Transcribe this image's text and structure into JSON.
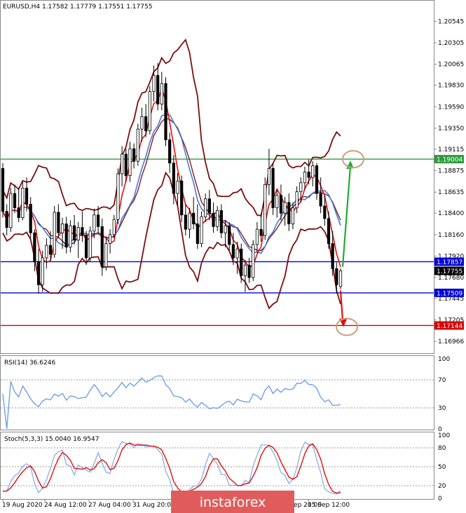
{
  "chart_data": [
    {
      "type": "candlestick",
      "title": "EURUSD,H4  1.17582 1.17779 1.17551 1.17755",
      "ylim": [
        1.1685,
        1.2065
      ],
      "y_ticks": [
        "1.20545",
        "1.20305",
        "1.20065",
        "1.19830",
        "1.19590",
        "1.19350",
        "1.19115",
        "1.18875",
        "1.18635",
        "1.18400",
        "1.18160",
        "1.17920",
        "1.17680",
        "1.17445",
        "1.17205",
        "1.16966"
      ],
      "x_ticks": [
        "19 Aug 2020",
        "24 Aug 12:00",
        "27 Aug 04:00",
        "31 Aug 20:00",
        "",
        "",
        "",
        "10 Sep 20:00",
        "15 Sep 12:00"
      ],
      "levels": [
        {
          "label": "1.19004",
          "value": 1.19004,
          "color": "#2e9b3e"
        },
        {
          "label": "1.17857",
          "value": 1.17857,
          "color": "#0000dd"
        },
        {
          "label": "1.17509",
          "value": 1.17509,
          "color": "#0000dd"
        },
        {
          "label": "1.17144",
          "value": 1.17144,
          "color": "#dd0000"
        }
      ],
      "current_price": "1.17755",
      "ohlc": [
        [
          1.189,
          1.1896,
          1.1835,
          1.1842
        ],
        [
          1.1842,
          1.185,
          1.1815,
          1.1824
        ],
        [
          1.1824,
          1.1868,
          1.1819,
          1.1862
        ],
        [
          1.1862,
          1.1872,
          1.184,
          1.1846
        ],
        [
          1.1846,
          1.1868,
          1.183,
          1.1835
        ],
        [
          1.1835,
          1.1875,
          1.1832,
          1.1868
        ],
        [
          1.1868,
          1.188,
          1.1842,
          1.185
        ],
        [
          1.185,
          1.1858,
          1.1812,
          1.1818
        ],
        [
          1.1818,
          1.1822,
          1.1775,
          1.1786
        ],
        [
          1.1786,
          1.18,
          1.175,
          1.176
        ],
        [
          1.176,
          1.1798,
          1.1752,
          1.179
        ],
        [
          1.179,
          1.1812,
          1.1778,
          1.1804
        ],
        [
          1.1804,
          1.182,
          1.1787,
          1.1794
        ],
        [
          1.1794,
          1.1848,
          1.179,
          1.1841
        ],
        [
          1.1841,
          1.185,
          1.1812,
          1.1818
        ],
        [
          1.1818,
          1.1835,
          1.18,
          1.1828
        ],
        [
          1.1828,
          1.1836,
          1.1795,
          1.1802
        ],
        [
          1.1802,
          1.1832,
          1.1796,
          1.1826
        ],
        [
          1.1826,
          1.1838,
          1.1805,
          1.181
        ],
        [
          1.181,
          1.183,
          1.179,
          1.1824
        ],
        [
          1.1824,
          1.1842,
          1.1808,
          1.1815
        ],
        [
          1.1815,
          1.182,
          1.1782,
          1.179
        ],
        [
          1.179,
          1.1825,
          1.1786,
          1.182
        ],
        [
          1.182,
          1.1845,
          1.1812,
          1.1838
        ],
        [
          1.1838,
          1.1848,
          1.1818,
          1.1825
        ],
        [
          1.1825,
          1.1834,
          1.177,
          1.178
        ],
        [
          1.178,
          1.1812,
          1.1776,
          1.1806
        ],
        [
          1.1806,
          1.1822,
          1.1795,
          1.1816
        ],
        [
          1.1816,
          1.1838,
          1.1812,
          1.1833
        ],
        [
          1.1833,
          1.189,
          1.1828,
          1.1884
        ],
        [
          1.1884,
          1.1915,
          1.187,
          1.1906
        ],
        [
          1.1906,
          1.1912,
          1.1875,
          1.1882
        ],
        [
          1.1882,
          1.192,
          1.1875,
          1.1912
        ],
        [
          1.1912,
          1.1918,
          1.189,
          1.1898
        ],
        [
          1.1898,
          1.194,
          1.1893,
          1.1934
        ],
        [
          1.1934,
          1.1958,
          1.192,
          1.1948
        ],
        [
          1.1948,
          1.1962,
          1.1925,
          1.1932
        ],
        [
          1.1932,
          1.1982,
          1.1928,
          1.1976
        ],
        [
          1.1976,
          1.2005,
          1.1965,
          1.1994
        ],
        [
          1.1994,
          1.2008,
          1.1955,
          1.1962
        ],
        [
          1.1962,
          1.1998,
          1.1955,
          1.1985
        ],
        [
          1.1985,
          1.1992,
          1.1915,
          1.1922
        ],
        [
          1.1922,
          1.193,
          1.1885,
          1.1896
        ],
        [
          1.1896,
          1.1905,
          1.185,
          1.1862
        ],
        [
          1.1862,
          1.1885,
          1.1848,
          1.1876
        ],
        [
          1.1876,
          1.1882,
          1.183,
          1.1838
        ],
        [
          1.1838,
          1.185,
          1.1815,
          1.1822
        ],
        [
          1.1822,
          1.1846,
          1.1812,
          1.184
        ],
        [
          1.184,
          1.1858,
          1.1822,
          1.1828
        ],
        [
          1.1828,
          1.185,
          1.18,
          1.1806
        ],
        [
          1.1806,
          1.1842,
          1.1802,
          1.1836
        ],
        [
          1.1836,
          1.1862,
          1.183,
          1.1856
        ],
        [
          1.1856,
          1.1866,
          1.1832,
          1.184
        ],
        [
          1.184,
          1.1852,
          1.1818,
          1.1825
        ],
        [
          1.1825,
          1.1848,
          1.182,
          1.1843
        ],
        [
          1.1843,
          1.185,
          1.1812,
          1.1818
        ],
        [
          1.1818,
          1.1832,
          1.1802,
          1.1826
        ],
        [
          1.1826,
          1.183,
          1.1798,
          1.1805
        ],
        [
          1.1805,
          1.1818,
          1.1782,
          1.179
        ],
        [
          1.179,
          1.1808,
          1.1772,
          1.18
        ],
        [
          1.18,
          1.1806,
          1.1762,
          1.177
        ],
        [
          1.177,
          1.1788,
          1.1752,
          1.1782
        ],
        [
          1.1782,
          1.179,
          1.1762,
          1.1768
        ],
        [
          1.1768,
          1.181,
          1.1764,
          1.1805
        ],
        [
          1.1805,
          1.183,
          1.1796,
          1.1822
        ],
        [
          1.1822,
          1.184,
          1.1808,
          1.1815
        ],
        [
          1.1815,
          1.188,
          1.181,
          1.1872
        ],
        [
          1.1872,
          1.1912,
          1.186,
          1.189
        ],
        [
          1.189,
          1.1896,
          1.1838,
          1.1846
        ],
        [
          1.1846,
          1.1866,
          1.1835,
          1.186
        ],
        [
          1.186,
          1.1872,
          1.1832,
          1.184
        ],
        [
          1.184,
          1.1858,
          1.1826,
          1.1852
        ],
        [
          1.1852,
          1.1862,
          1.182,
          1.1828
        ],
        [
          1.1828,
          1.1852,
          1.1822,
          1.1846
        ],
        [
          1.1846,
          1.187,
          1.184,
          1.1864
        ],
        [
          1.1864,
          1.188,
          1.1852,
          1.1874
        ],
        [
          1.1874,
          1.1892,
          1.1866,
          1.1886
        ],
        [
          1.1886,
          1.19,
          1.1872,
          1.188
        ],
        [
          1.188,
          1.1898,
          1.187,
          1.1893
        ],
        [
          1.1893,
          1.1896,
          1.1855,
          1.1862
        ],
        [
          1.1862,
          1.188,
          1.184,
          1.1848
        ],
        [
          1.1848,
          1.186,
          1.1826,
          1.1834
        ],
        [
          1.1834,
          1.1842,
          1.18,
          1.1806
        ],
        [
          1.1806,
          1.182,
          1.177,
          1.1778
        ],
        [
          1.1778,
          1.1785,
          1.175,
          1.176
        ],
        [
          1.1758,
          1.1778,
          1.1755,
          1.17755
        ]
      ],
      "overlays": {
        "bollinger_bands": "dark red",
        "moving_average_fast": "red",
        "moving_average_slow": "blue"
      },
      "annotations": [
        {
          "type": "arrow",
          "color": "green",
          "direction": "up",
          "target": 1.19004
        },
        {
          "type": "arrow",
          "color": "red",
          "direction": "down",
          "target": 1.17144
        }
      ]
    },
    {
      "type": "line",
      "title": "RSI(14) 36.6246",
      "ylim": [
        0,
        100
      ],
      "y_ticks": [
        "100",
        "70",
        "30",
        "0"
      ],
      "levels": [
        70,
        30
      ]
    },
    {
      "type": "line",
      "title": "Stoch(5,3,3) 15.0040 16.9547",
      "ylim": [
        0,
        100
      ],
      "y_ticks": [
        "100",
        "80",
        "50",
        "20",
        "0"
      ],
      "levels": [
        80,
        50,
        20
      ]
    }
  ],
  "watermark": "instaforex",
  "colors": {
    "candle": "#000000",
    "band": "#7a0f0f",
    "ma_fast": "#e01010",
    "ma_slow": "#4a78d8",
    "rsi_line": "#6fa0e8",
    "stoch_main": "#8fb4ea",
    "stoch_signal": "#e01010",
    "watermark_bg": "#e05c5c"
  }
}
